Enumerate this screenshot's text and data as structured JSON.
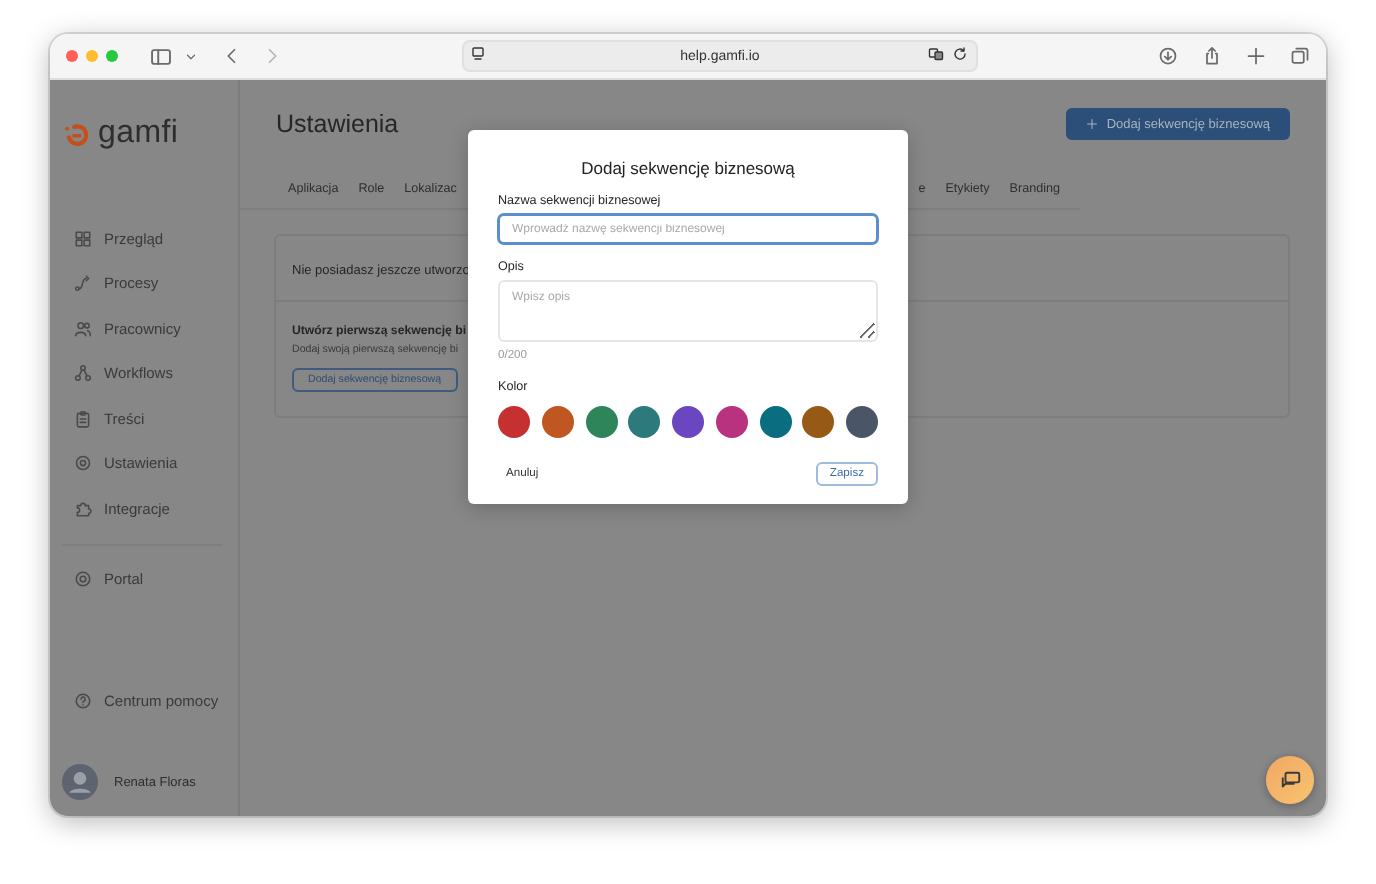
{
  "browser": {
    "url": "help.gamfi.io"
  },
  "sidebar": {
    "logo": "gamfi",
    "items": [
      {
        "label": "Przegląd"
      },
      {
        "label": "Procesy"
      },
      {
        "label": "Pracownicy"
      },
      {
        "label": "Workflows"
      },
      {
        "label": "Treści"
      },
      {
        "label": "Ustawienia"
      },
      {
        "label": "Integracje"
      }
    ],
    "portal": "Portal",
    "help": "Centrum pomocy",
    "user": "Renata Floras"
  },
  "main": {
    "title": "Ustawienia",
    "add_button": "Dodaj sekwencję biznesową",
    "tabs_left": [
      {
        "label": "Aplikacja"
      },
      {
        "label": "Role"
      },
      {
        "label": "Lokalizac"
      }
    ],
    "tabs_right": [
      {
        "label": "e"
      },
      {
        "label": "Etykiety"
      },
      {
        "label": "Branding"
      }
    ],
    "card": {
      "empty_message": "Nie posiadasz jeszcze utworzo",
      "cta_title": "Utwórz pierwszą sekwencję bi",
      "cta_text": "Dodaj swoją pierwszą sekwencję bi",
      "cta_button": "Dodaj sekwencję biznesową"
    }
  },
  "modal": {
    "title": "Dodaj sekwencję biznesową",
    "name_field": {
      "label": "Nazwa sekwencji biznesowej",
      "placeholder": "Wprowadź nazwę sekwencji biznesowej",
      "focused": true
    },
    "description_field": {
      "label": "Opis",
      "placeholder": "Wpisz opis",
      "counter": "0/200"
    },
    "color_label": "Kolor",
    "colors": [
      {
        "color": "#c53030"
      },
      {
        "color": "#c05621"
      },
      {
        "color": "#2f855a"
      },
      {
        "color": "#2c7a7b"
      },
      {
        "color": "#6b46c1"
      },
      {
        "color": "#b83280"
      },
      {
        "color": "#0b6e80"
      },
      {
        "color": "#975a16"
      },
      {
        "color": "#4a5568"
      }
    ],
    "cancel": "Anuluj",
    "save": "Zapisz"
  }
}
